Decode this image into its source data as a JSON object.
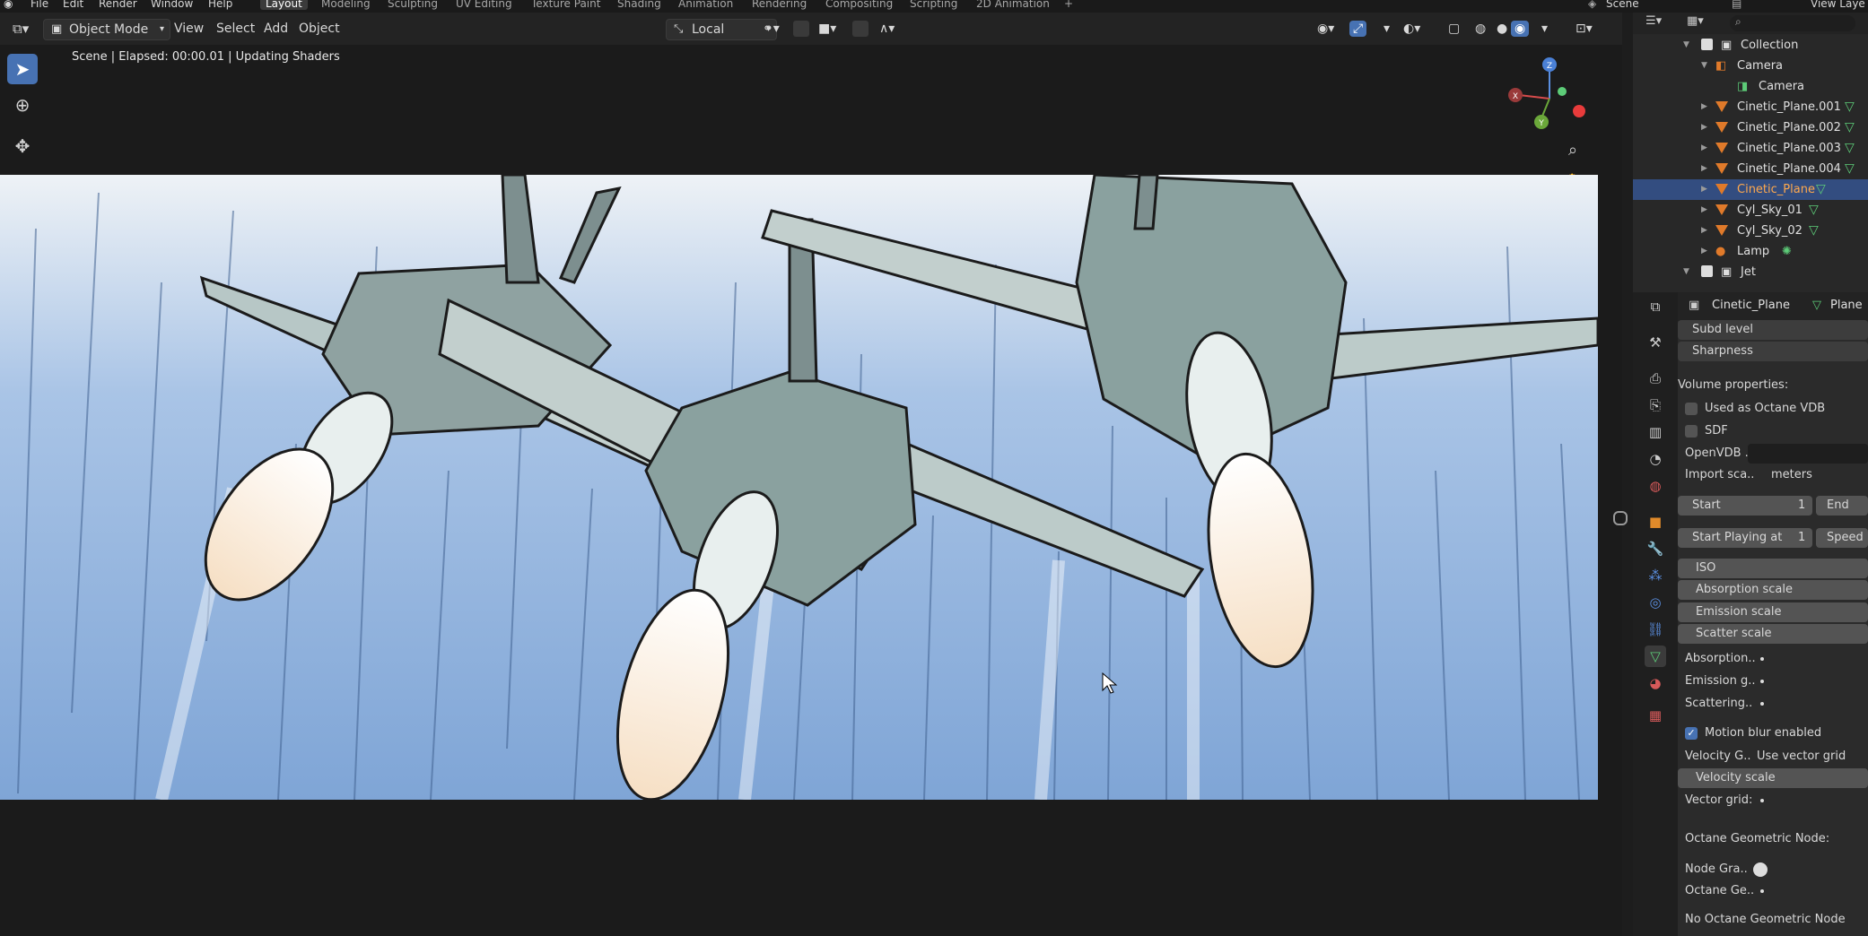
{
  "topbar": {
    "menus": [
      "File",
      "Edit",
      "Render",
      "Window",
      "Help"
    ],
    "workspaces": [
      "Layout",
      "Modeling",
      "Sculpting",
      "UV Editing",
      "Texture Paint",
      "Shading",
      "Animation",
      "Rendering",
      "Compositing",
      "Scripting",
      "2D Animation"
    ],
    "active_workspace": "Layout",
    "add_tab": "+",
    "scene_label": "Scene",
    "view_layer_label": "View Laye"
  },
  "viewport_header": {
    "mode": "Object Mode",
    "menus": [
      "View",
      "Select",
      "Add",
      "Object"
    ],
    "transform_orientation": "Local"
  },
  "viewport": {
    "status": "Scene | Elapsed: 00:00.01 | Updating Shaders",
    "gizmo_axes": {
      "x": "X",
      "y": "Y",
      "z": "Z"
    }
  },
  "outliner": {
    "items": [
      {
        "label": "Collection",
        "kind": "collection",
        "indent": 0
      },
      {
        "label": "Camera",
        "kind": "object-camera",
        "indent": 1
      },
      {
        "label": "Camera",
        "kind": "camera-data",
        "indent": 2
      },
      {
        "label": "Cinetic_Plane.001",
        "kind": "mesh",
        "indent": 1
      },
      {
        "label": "Cinetic_Plane.002",
        "kind": "mesh",
        "indent": 1
      },
      {
        "label": "Cinetic_Plane.003",
        "kind": "mesh",
        "indent": 1
      },
      {
        "label": "Cinetic_Plane.004",
        "kind": "mesh",
        "indent": 1
      },
      {
        "label": "Cinetic_Plane",
        "kind": "mesh",
        "indent": 1,
        "selected": true
      },
      {
        "label": "Cyl_Sky_01",
        "kind": "mesh",
        "indent": 1
      },
      {
        "label": "Cyl_Sky_02",
        "kind": "mesh",
        "indent": 1
      },
      {
        "label": "Lamp",
        "kind": "lamp",
        "indent": 1
      },
      {
        "label": "Jet",
        "kind": "collection",
        "indent": 0
      }
    ]
  },
  "properties": {
    "object_name": "Cinetic_Plane",
    "data_name": "Plane",
    "rows": {
      "subd_level": "Subd level",
      "sharpness": "Sharpness",
      "volume_header": "Volume properties:",
      "used_as_vdb": "Used as Octane VDB",
      "sdf": "SDF",
      "openvdb": "OpenVDB ..",
      "import_scale_label": "Import sca..",
      "import_scale_value": "meters",
      "start_label": "Start",
      "start_value": "1",
      "end_label": "End",
      "start_playing_label": "Start Playing at",
      "start_playing_value": "1",
      "speed_label": "Speed",
      "iso": "ISO",
      "absorption_scale": "Absorption scale",
      "emission_scale": "Emission scale",
      "scatter_scale": "Scatter scale",
      "absorption": "Absorption..",
      "emission_g": "Emission g..",
      "scattering": "Scattering..",
      "motion_blur": "Motion blur enabled",
      "velocity_g_label": "Velocity G..",
      "velocity_g_value": "Use vector grid",
      "velocity_scale": "Velocity scale",
      "vector_grid": "Vector grid:",
      "octane_geo_header": "Octane Geometric Node:",
      "node_graph": "Node Gra..",
      "octane_ge": "Octane Ge..",
      "no_octane_geo": "No Octane Geometric Node"
    },
    "checkbox_state": {
      "used_as_vdb": false,
      "sdf": false,
      "motion_blur": true
    }
  },
  "colors": {
    "accent": "#4772b3",
    "selection": "#334d80",
    "object_orange": "#ffa94d",
    "mesh_green": "#5dcc78",
    "sky_blue": "#8fb3df"
  }
}
